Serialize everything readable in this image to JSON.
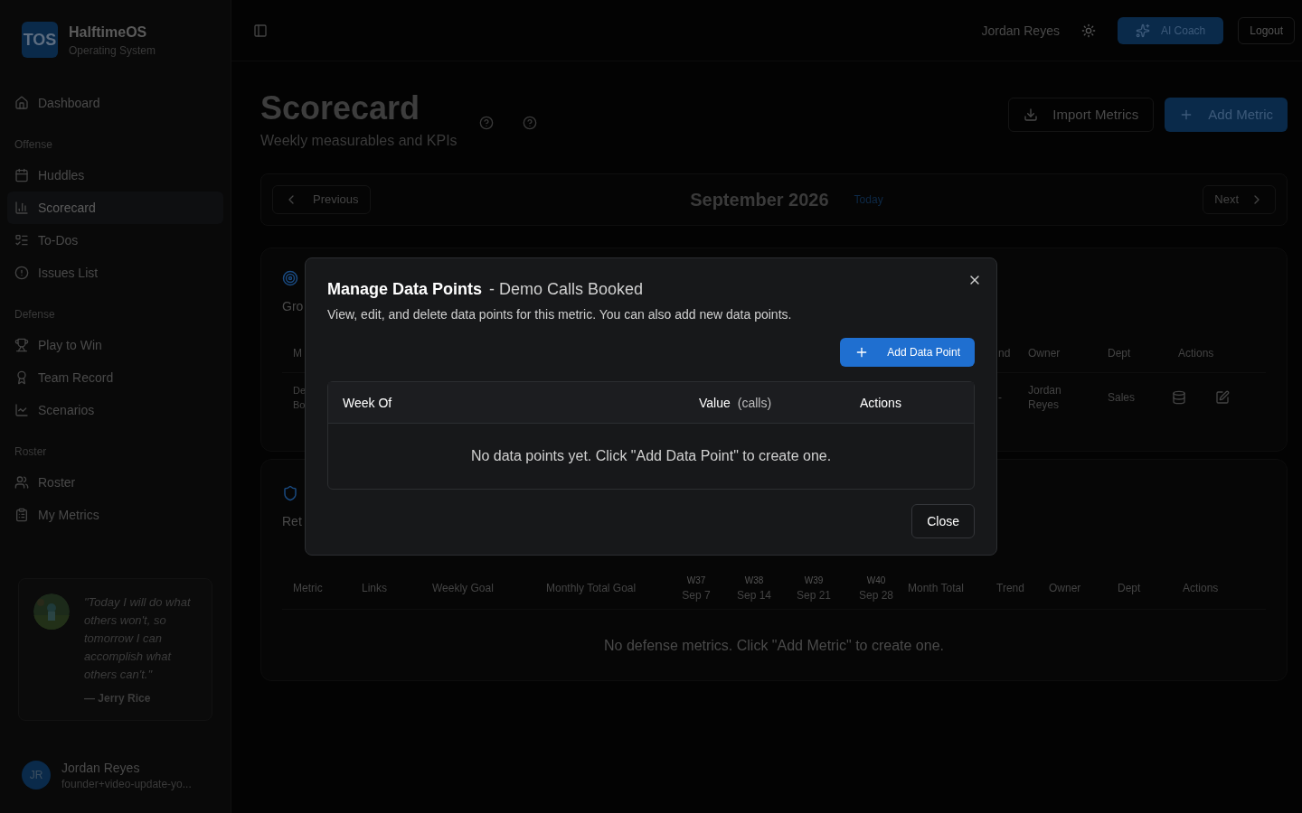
{
  "sidebar": {
    "brand": {
      "logo": "TOS",
      "name": "HalftimeOS",
      "subtitle": "Operating System"
    },
    "sections": [
      {
        "items": [
          {
            "label": "Dashboard",
            "selected": false
          }
        ]
      },
      {
        "label": "Offense",
        "items": [
          {
            "label": "Huddles",
            "selected": false
          },
          {
            "label": "Scorecard",
            "selected": true
          },
          {
            "label": "To-Dos",
            "selected": false
          },
          {
            "label": "Issues List",
            "selected": false
          }
        ]
      },
      {
        "label": "Defense",
        "items": [
          {
            "label": "Play to Win",
            "selected": false
          },
          {
            "label": "Team Record",
            "selected": false
          },
          {
            "label": "Scenarios",
            "selected": false
          }
        ]
      },
      {
        "label": "Roster",
        "items": [
          {
            "label": "Roster",
            "selected": false
          },
          {
            "label": "My Metrics",
            "selected": false
          }
        ]
      }
    ],
    "quote": {
      "text": "\"Today I will do what others won't, so tomorrow I can accomplish what others can't.\"",
      "author": "— Jerry Rice"
    },
    "user": {
      "initials": "JR",
      "name": "Jordan Reyes",
      "email": "founder+video-update-yo..."
    }
  },
  "topbar": {
    "user_name": "Jordan Reyes",
    "coach_button": "AI Coach",
    "logout_button": "Logout"
  },
  "page": {
    "title": "Scorecard",
    "subtitle": "Weekly measurables and KPIs",
    "import_button": "Import Metrics",
    "add_button": "Add Metric"
  },
  "period": {
    "previous": "Previous",
    "month": "September 2026",
    "today": "Today",
    "next": "Next"
  },
  "offense_card": {
    "subtitle": "Gro",
    "columns": [
      "M",
      "nd",
      "Owner",
      "Dept",
      "Actions"
    ],
    "row": {
      "metric": [
        "De",
        "Bo"
      ],
      "trend": "-",
      "owner": "Jordan Reyes",
      "dept": "Sales"
    }
  },
  "defense_card": {
    "subtitle": "Ret",
    "columns": [
      {
        "label": "Metric"
      },
      {
        "label": "Links"
      },
      {
        "label": "Weekly Goal"
      },
      {
        "label": "Monthly Total Goal"
      },
      {
        "week": "W37",
        "label": "Sep 7"
      },
      {
        "week": "W38",
        "label": "Sep 14"
      },
      {
        "week": "W39",
        "label": "Sep 21"
      },
      {
        "week": "W40",
        "label": "Sep 28"
      },
      {
        "label": "Month Total"
      },
      {
        "label": "Trend"
      },
      {
        "label": "Owner"
      },
      {
        "label": "Dept"
      },
      {
        "label": "Actions"
      }
    ],
    "empty": "No defense metrics. Click \"Add Metric\" to create one."
  },
  "modal": {
    "title": "Manage Data Points",
    "metric": "- Demo Calls Booked",
    "description": "View, edit, and delete data points for this metric. You can also add new data points.",
    "add_button": "Add Data Point",
    "columns": [
      {
        "label": "Week Of"
      },
      {
        "label": "Value",
        "unit": "(calls)"
      },
      {
        "label": "Actions"
      }
    ],
    "empty": "No data points yet. Click \"Add Data Point\" to create one.",
    "close_button": "Close"
  }
}
